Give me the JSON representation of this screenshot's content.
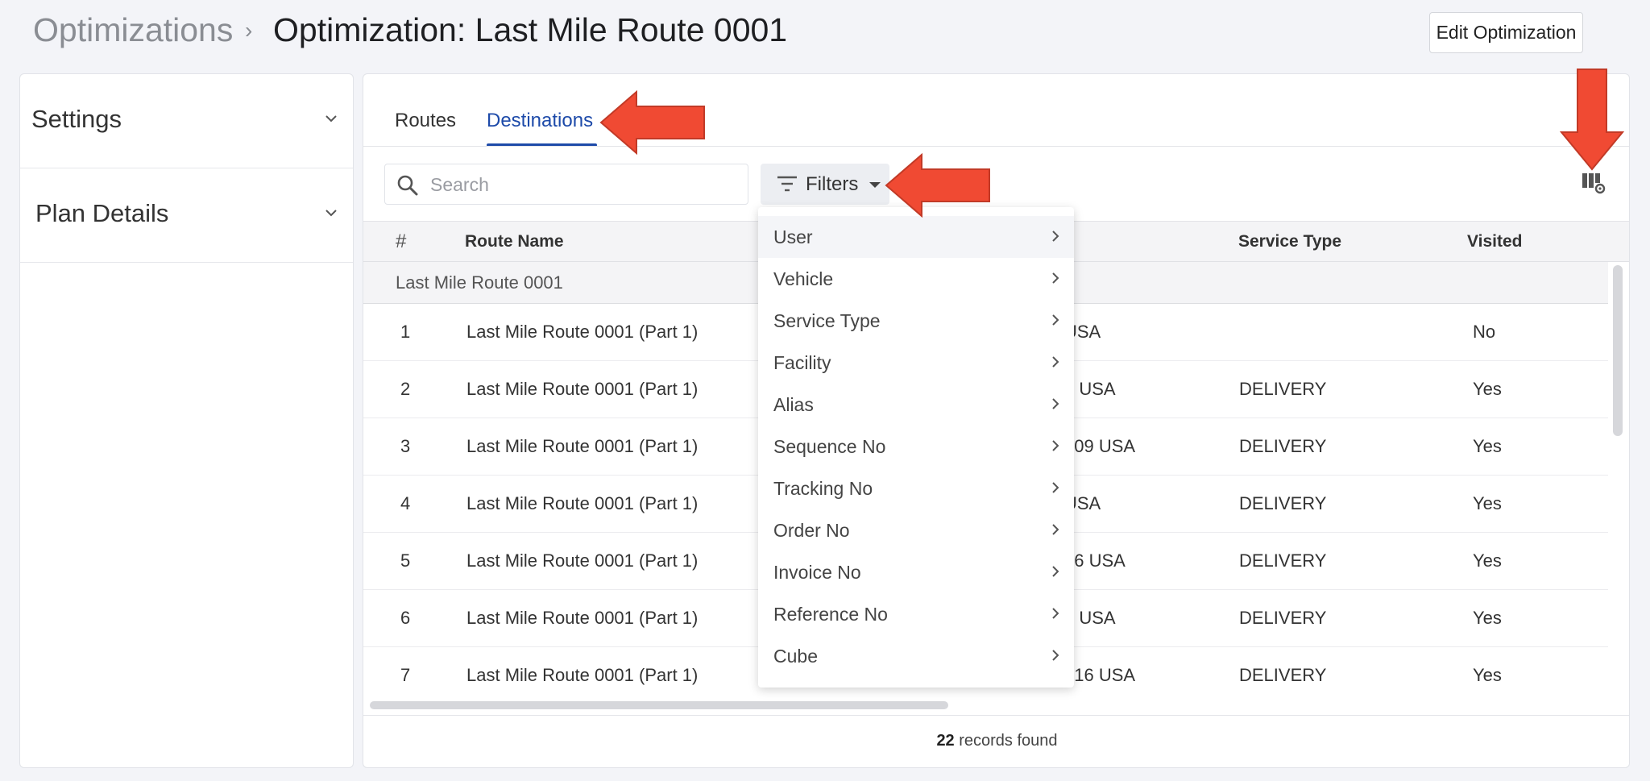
{
  "breadcrumb": {
    "root": "Optimizations",
    "separator": "›",
    "title": "Optimization: Last Mile Route 0001"
  },
  "header": {
    "edit_button": "Edit Optimization"
  },
  "sidebar": {
    "sections": [
      "Settings",
      "Plan Details"
    ]
  },
  "tabs": {
    "routes": "Routes",
    "destinations": "Destinations",
    "active": "Destinations"
  },
  "toolbar": {
    "search_placeholder": "Search",
    "filters_label": "Filters"
  },
  "table": {
    "headers": {
      "num": "#",
      "route_name": "Route Name",
      "service_type": "Service Type",
      "visited": "Visited"
    },
    "group_label": "Last Mile Route 0001",
    "rows": [
      {
        "num": "1",
        "route_name": "Last Mile Route 0001 (Part 1)",
        "address": "USA",
        "service_type": "",
        "visited": "No"
      },
      {
        "num": "2",
        "route_name": "Last Mile Route 0001 (Part 1)",
        "address": "6 USA",
        "service_type": "DELIVERY",
        "visited": "Yes"
      },
      {
        "num": "3",
        "route_name": "Last Mile Route 0001 (Part 1)",
        "address": "009 USA",
        "service_type": "DELIVERY",
        "visited": "Yes"
      },
      {
        "num": "4",
        "route_name": "Last Mile Route 0001 (Part 1)",
        "address": "USA",
        "service_type": "DELIVERY",
        "visited": "Yes"
      },
      {
        "num": "5",
        "route_name": "Last Mile Route 0001 (Part 1)",
        "address": "56 USA",
        "service_type": "DELIVERY",
        "visited": "Yes"
      },
      {
        "num": "6",
        "route_name": "Last Mile Route 0001 (Part 1)",
        "address": "1 USA",
        "service_type": "DELIVERY",
        "visited": "Yes"
      },
      {
        "num": "7",
        "route_name": "Last Mile Route 0001 (Part 1)",
        "address": "016 USA",
        "service_type": "DELIVERY",
        "visited": "Yes"
      }
    ]
  },
  "filters_menu": {
    "items": [
      "User",
      "Vehicle",
      "Service Type",
      "Facility",
      "Alias",
      "Sequence No",
      "Tracking No",
      "Order No",
      "Invoice No",
      "Reference No",
      "Cube"
    ],
    "highlighted": "User"
  },
  "footer": {
    "count": "22",
    "suffix": " records found"
  },
  "colors": {
    "accent": "#1d4aa9",
    "arrow": "#f04a33"
  }
}
